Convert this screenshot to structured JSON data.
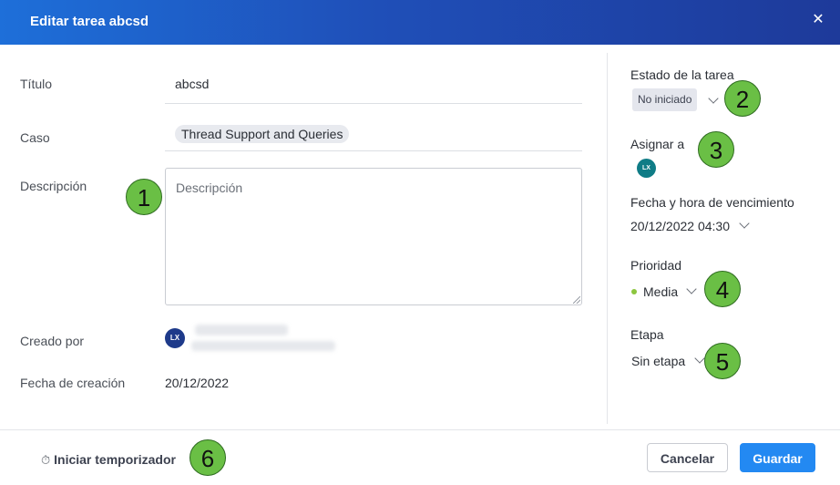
{
  "dialog": {
    "title": "Editar tarea abcsd",
    "close_icon": "close-icon"
  },
  "form": {
    "titulo_label": "Título",
    "titulo_value": "abcsd",
    "caso_label": "Caso",
    "caso_value": "Thread Support and Queries",
    "descripcion_label": "Descripción",
    "descripcion_placeholder": "Descripción",
    "creado_por_label": "Creado por",
    "creado_por_avatar": "LX",
    "fecha_creacion_label": "Fecha de creación",
    "fecha_creacion_value": "20/12/2022"
  },
  "sidebar": {
    "estado_label": "Estado de la tarea",
    "estado_value": "No iniciado",
    "asignar_label": "Asignar a",
    "asignar_avatar": "LX",
    "vencimiento_label": "Fecha y hora de vencimiento",
    "vencimiento_value": "20/12/2022 04:30",
    "prioridad_label": "Prioridad",
    "prioridad_value": "Media",
    "prioridad_color": "#8cc63f",
    "etapa_label": "Etapa",
    "etapa_value": "Sin etapa"
  },
  "footer": {
    "timer_icon": "stopwatch-icon",
    "timer_label": "Iniciar temporizador",
    "cancel_label": "Cancelar",
    "save_label": "Guardar"
  },
  "annotations": [
    "1",
    "2",
    "3",
    "4",
    "5",
    "6"
  ],
  "colors": {
    "header_start": "#1e6fd9",
    "header_end": "#1e3a9a",
    "primary_button": "#2389f2",
    "badge_green": "#6abf45"
  }
}
